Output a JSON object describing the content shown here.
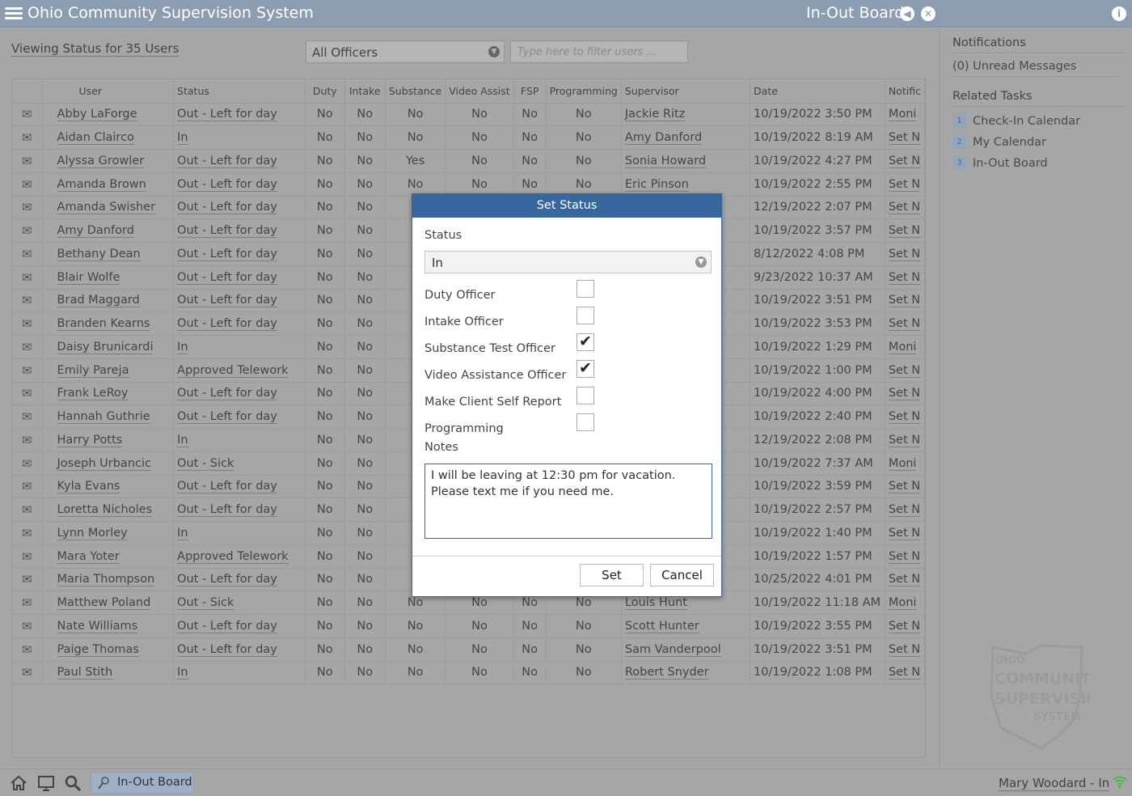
{
  "app": {
    "title": "Ohio Community Supervision System",
    "page_title": "In-Out Board"
  },
  "toolbar": {
    "viewing": "Viewing Status for 35 Users",
    "officer_filter": "All Officers",
    "filter_placeholder": "Type here to filter users ..."
  },
  "table": {
    "headers": [
      "User",
      "Status",
      "Duty",
      "Intake",
      "Substance",
      "Video Assist",
      "FSP",
      "Programming",
      "Supervisor",
      "Date",
      "Notific"
    ],
    "rows": [
      {
        "user": "Abby LaForge",
        "status": "Out - Left for day",
        "duty": "No",
        "intake": "No",
        "substance": "No",
        "video": "No",
        "fsp": "No",
        "prog": "No",
        "supervisor": "Jackie Ritz",
        "date": "10/19/2022 3:50 PM",
        "notif": "Moni"
      },
      {
        "user": "Aidan Clairco",
        "status": "In",
        "duty": "No",
        "intake": "No",
        "substance": "No",
        "video": "No",
        "fsp": "No",
        "prog": "No",
        "supervisor": "Amy Danford",
        "date": "10/19/2022 8:19 AM",
        "notif": "Set N"
      },
      {
        "user": "Alyssa Growler",
        "status": "Out - Left for day",
        "duty": "No",
        "intake": "No",
        "substance": "Yes",
        "video": "No",
        "fsp": "No",
        "prog": "No",
        "supervisor": "Sonia Howard",
        "date": "10/19/2022 4:27 PM",
        "notif": "Set N"
      },
      {
        "user": "Amanda Brown",
        "status": "Out - Left for day",
        "duty": "No",
        "intake": "No",
        "substance": "No",
        "video": "No",
        "fsp": "No",
        "prog": "No",
        "supervisor": "Eric Pinson",
        "date": "10/19/2022 2:55 PM",
        "notif": "Set N"
      },
      {
        "user": "Amanda Swisher",
        "status": "Out - Left for day",
        "duty": "No",
        "intake": "No",
        "substance": "",
        "video": "",
        "fsp": "",
        "prog": "",
        "supervisor": "",
        "date": "12/19/2022 2:07 PM",
        "notif": "Set N"
      },
      {
        "user": "Amy Danford",
        "status": "Out - Left for day",
        "duty": "No",
        "intake": "No",
        "substance": "",
        "video": "",
        "fsp": "",
        "prog": "",
        "supervisor": "",
        "date": "10/19/2022 3:57 PM",
        "notif": "Set N"
      },
      {
        "user": "Bethany Dean",
        "status": "Out - Left for day",
        "duty": "No",
        "intake": "No",
        "substance": "",
        "video": "",
        "fsp": "",
        "prog": "",
        "supervisor": "",
        "date": "8/12/2022 4:08 PM",
        "notif": "Set N"
      },
      {
        "user": "Blair Wolfe",
        "status": "Out - Left for day",
        "duty": "No",
        "intake": "No",
        "substance": "",
        "video": "",
        "fsp": "",
        "prog": "",
        "supervisor": "",
        "date": "9/23/2022 10:37 AM",
        "notif": "Set N"
      },
      {
        "user": "Brad Maggard",
        "status": "Out - Left for day",
        "duty": "No",
        "intake": "No",
        "substance": "",
        "video": "",
        "fsp": "",
        "prog": "",
        "supervisor": "",
        "date": "10/19/2022 3:51 PM",
        "notif": "Set N"
      },
      {
        "user": "Branden Kearns",
        "status": "Out - Left for day",
        "duty": "No",
        "intake": "No",
        "substance": "",
        "video": "",
        "fsp": "",
        "prog": "",
        "supervisor": "",
        "date": "10/19/2022 3:53 PM",
        "notif": "Set N"
      },
      {
        "user": "Daisy Brunicardi",
        "status": "In",
        "duty": "No",
        "intake": "No",
        "substance": "",
        "video": "",
        "fsp": "",
        "prog": "",
        "supervisor": "",
        "date": "10/19/2022 1:29 PM",
        "notif": "Moni"
      },
      {
        "user": "Emily Pareja",
        "status": "Approved Telework",
        "duty": "No",
        "intake": "No",
        "substance": "",
        "video": "",
        "fsp": "",
        "prog": "",
        "supervisor": "",
        "date": "10/19/2022 1:00 PM",
        "notif": "Set N"
      },
      {
        "user": "Frank LeRoy",
        "status": "Out - Left for day",
        "duty": "No",
        "intake": "No",
        "substance": "",
        "video": "",
        "fsp": "",
        "prog": "",
        "supervisor": "",
        "date": "10/19/2022 4:00 PM",
        "notif": "Set N"
      },
      {
        "user": "Hannah Guthrie",
        "status": "Out - Left for day",
        "duty": "No",
        "intake": "No",
        "substance": "",
        "video": "",
        "fsp": "",
        "prog": "",
        "supervisor": "",
        "date": "10/19/2022 2:40 PM",
        "notif": "Set N"
      },
      {
        "user": "Harry Potts",
        "status": "In",
        "duty": "No",
        "intake": "No",
        "substance": "",
        "video": "",
        "fsp": "",
        "prog": "",
        "supervisor": "",
        "date": "12/19/2022 2:08 PM",
        "notif": "Set N"
      },
      {
        "user": "Joseph Urbancic",
        "status": "Out - Sick",
        "duty": "No",
        "intake": "No",
        "substance": "",
        "video": "",
        "fsp": "",
        "prog": "",
        "supervisor": "",
        "date": "10/19/2022 7:37 AM",
        "notif": "Moni"
      },
      {
        "user": "Kyla Evans",
        "status": "Out - Left for day",
        "duty": "No",
        "intake": "No",
        "substance": "",
        "video": "",
        "fsp": "",
        "prog": "",
        "supervisor": "",
        "date": "10/19/2022 3:59 PM",
        "notif": "Set N"
      },
      {
        "user": "Loretta Nicholes",
        "status": "Out - Left for day",
        "duty": "No",
        "intake": "No",
        "substance": "",
        "video": "",
        "fsp": "",
        "prog": "",
        "supervisor": "",
        "date": "10/19/2022 2:57 PM",
        "notif": "Set N"
      },
      {
        "user": "Lynn Morley",
        "status": "In",
        "duty": "No",
        "intake": "No",
        "substance": "",
        "video": "",
        "fsp": "",
        "prog": "",
        "supervisor": "",
        "date": "10/19/2022 1:40 PM",
        "notif": "Set N"
      },
      {
        "user": "Mara Yoter",
        "status": "Approved Telework",
        "duty": "No",
        "intake": "No",
        "substance": "",
        "video": "",
        "fsp": "",
        "prog": "",
        "supervisor": "",
        "date": "10/19/2022 1:57 PM",
        "notif": "Set N"
      },
      {
        "user": "Maria Thompson",
        "status": "Out - Left for day",
        "duty": "No",
        "intake": "No",
        "substance": "",
        "video": "",
        "fsp": "",
        "prog": "",
        "supervisor": "",
        "date": "10/25/2022 4:01 PM",
        "notif": "Set N"
      },
      {
        "user": "Matthew Poland",
        "status": "Out - Sick",
        "duty": "No",
        "intake": "No",
        "substance": "No",
        "video": "No",
        "fsp": "No",
        "prog": "No",
        "supervisor": "Louis Hunt",
        "date": "10/19/2022 11:18 AM",
        "notif": "Moni"
      },
      {
        "user": "Nate Williams",
        "status": "Out - Left for day",
        "duty": "No",
        "intake": "No",
        "substance": "No",
        "video": "No",
        "fsp": "No",
        "prog": "No",
        "supervisor": "Scott Hunter",
        "date": "10/19/2022 3:55 PM",
        "notif": "Set N"
      },
      {
        "user": "Paige Thomas",
        "status": "Out - Left for day",
        "duty": "No",
        "intake": "No",
        "substance": "No",
        "video": "No",
        "fsp": "No",
        "prog": "No",
        "supervisor": "Sam Vanderpool",
        "date": "10/19/2022 3:51 PM",
        "notif": "Set N"
      },
      {
        "user": "Paul Stith",
        "status": "In",
        "duty": "No",
        "intake": "No",
        "substance": "No",
        "video": "No",
        "fsp": "No",
        "prog": "No",
        "supervisor": "Robert Snyder",
        "date": "10/19/2022 1:08 PM",
        "notif": "Set N"
      }
    ]
  },
  "sidebar": {
    "notifications_title": "Notifications",
    "unread": "(0) Unread Messages",
    "tasks_title": "Related Tasks",
    "tasks": [
      {
        "num": "1",
        "label": "Check-In Calendar"
      },
      {
        "num": "2",
        "label": "My Calendar"
      },
      {
        "num": "3",
        "label": "In-Out Board"
      }
    ],
    "logo_lines": [
      "OHIO",
      "COMMUNITY",
      "SUPERVISION",
      "SYSTEM"
    ]
  },
  "bottom": {
    "task_label": "In-Out Board",
    "user_status": "Mary Woodard - In"
  },
  "modal": {
    "title": "Set Status",
    "status_label": "Status",
    "status_value": "In",
    "checkboxes": [
      {
        "label": "Duty Officer",
        "checked": false
      },
      {
        "label": "Intake Officer",
        "checked": false
      },
      {
        "label": "Substance Test Officer",
        "checked": true
      },
      {
        "label": "Video Assistance Officer",
        "checked": true
      },
      {
        "label": "Make Client Self Report",
        "checked": false
      },
      {
        "label": "Programming",
        "checked": false
      }
    ],
    "notes_label": "Notes",
    "notes_value": "I will be leaving at 12:30 pm for vacation. Please text me if you need me.",
    "set_label": "Set",
    "cancel_label": "Cancel"
  },
  "colors": {
    "titlebar": "#8c9cb1",
    "modal_header": "#37679c",
    "accent": "#3b6699"
  },
  "icons": [
    "menu-icon",
    "back-icon",
    "close-icon",
    "info-icon",
    "mail-icon",
    "home-icon",
    "monitor-icon",
    "search-icon",
    "user-search-icon",
    "wifi-icon"
  ]
}
